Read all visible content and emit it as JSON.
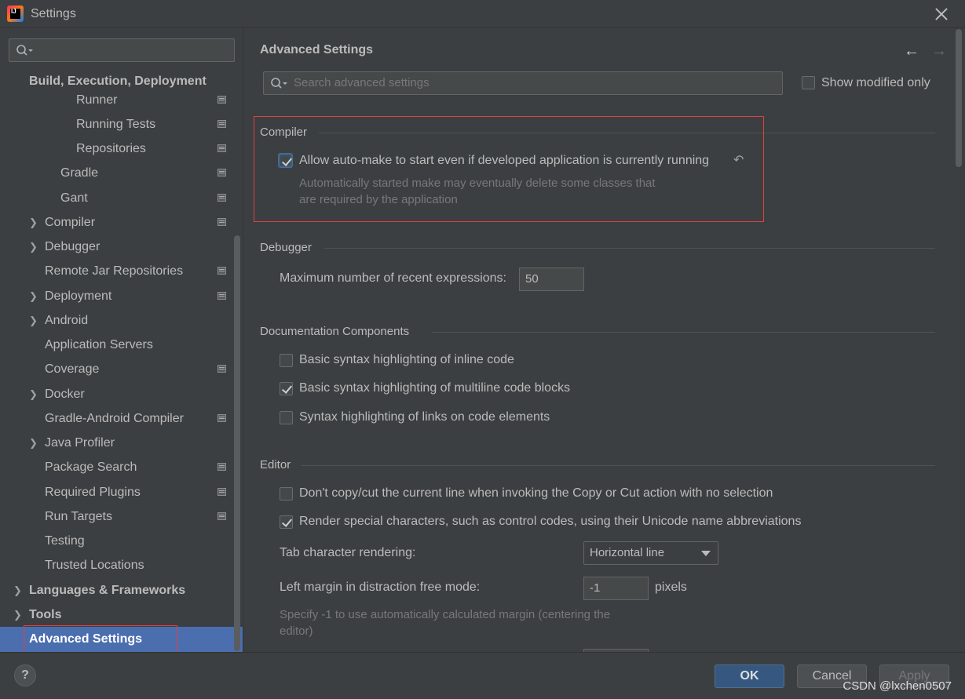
{
  "window": {
    "title": "Settings"
  },
  "sidebar": {
    "search_placeholder": "",
    "items": [
      {
        "label": "Build, Execution, Deployment",
        "bold": true
      },
      {
        "label": "Runner"
      },
      {
        "label": "Running Tests"
      },
      {
        "label": "Repositories"
      },
      {
        "label": "Gradle"
      },
      {
        "label": "Gant"
      },
      {
        "label": "Compiler"
      },
      {
        "label": "Debugger"
      },
      {
        "label": "Remote Jar Repositories"
      },
      {
        "label": "Deployment"
      },
      {
        "label": "Android"
      },
      {
        "label": "Application Servers"
      },
      {
        "label": "Coverage"
      },
      {
        "label": "Docker"
      },
      {
        "label": "Gradle-Android Compiler"
      },
      {
        "label": "Java Profiler"
      },
      {
        "label": "Package Search"
      },
      {
        "label": "Required Plugins"
      },
      {
        "label": "Run Targets"
      },
      {
        "label": "Testing"
      },
      {
        "label": "Trusted Locations"
      },
      {
        "label": "Languages & Frameworks",
        "bold": true
      },
      {
        "label": "Tools",
        "bold": true
      },
      {
        "label": "Advanced Settings",
        "bold": true,
        "selected": true
      }
    ]
  },
  "main": {
    "title": "Advanced Settings",
    "search_placeholder": "Search advanced settings",
    "show_modified_only": {
      "label": "Show modified only",
      "checked": false
    },
    "sections": {
      "compiler": {
        "title": "Compiler",
        "auto_make": {
          "label": "Allow auto-make to start even if developed application is currently running",
          "checked": true,
          "hint_line1": "Automatically started make may eventually delete some classes that",
          "hint_line2": "are required by the application"
        }
      },
      "debugger": {
        "title": "Debugger",
        "max_recent_label": "Maximum number of recent expressions:",
        "max_recent_value": "50"
      },
      "documentation": {
        "title": "Documentation Components",
        "inline_code": {
          "label": "Basic syntax highlighting of inline code",
          "checked": false
        },
        "multiline_code": {
          "label": "Basic syntax highlighting of multiline code blocks",
          "checked": true
        },
        "links": {
          "label": "Syntax highlighting of links on code elements",
          "checked": false
        }
      },
      "editor": {
        "title": "Editor",
        "no_copy_cut": {
          "label": "Don't copy/cut the current line when invoking the Copy or Cut action with no selection",
          "checked": false
        },
        "render_special": {
          "label": "Render special characters, such as control codes, using their Unicode name abbreviations",
          "checked": true
        },
        "tab_rendering_label": "Tab character rendering:",
        "tab_rendering_value": "Horizontal line",
        "left_margin_label": "Left margin in distraction free mode:",
        "left_margin_value": "-1",
        "left_margin_unit": "pixels",
        "left_margin_hint_line1": "Specify -1 to use automatically calculated margin (centering the",
        "left_margin_hint_line2": "editor)"
      }
    }
  },
  "footer": {
    "help_label": "?",
    "ok_label": "OK",
    "cancel_label": "Cancel",
    "apply_label": "Apply",
    "watermark": "CSDN @lxchen0507"
  },
  "colors": {
    "background": "#3c3f41",
    "selection": "#4b6eaf",
    "highlight_box": "#e04040",
    "primary_button": "#365880"
  }
}
